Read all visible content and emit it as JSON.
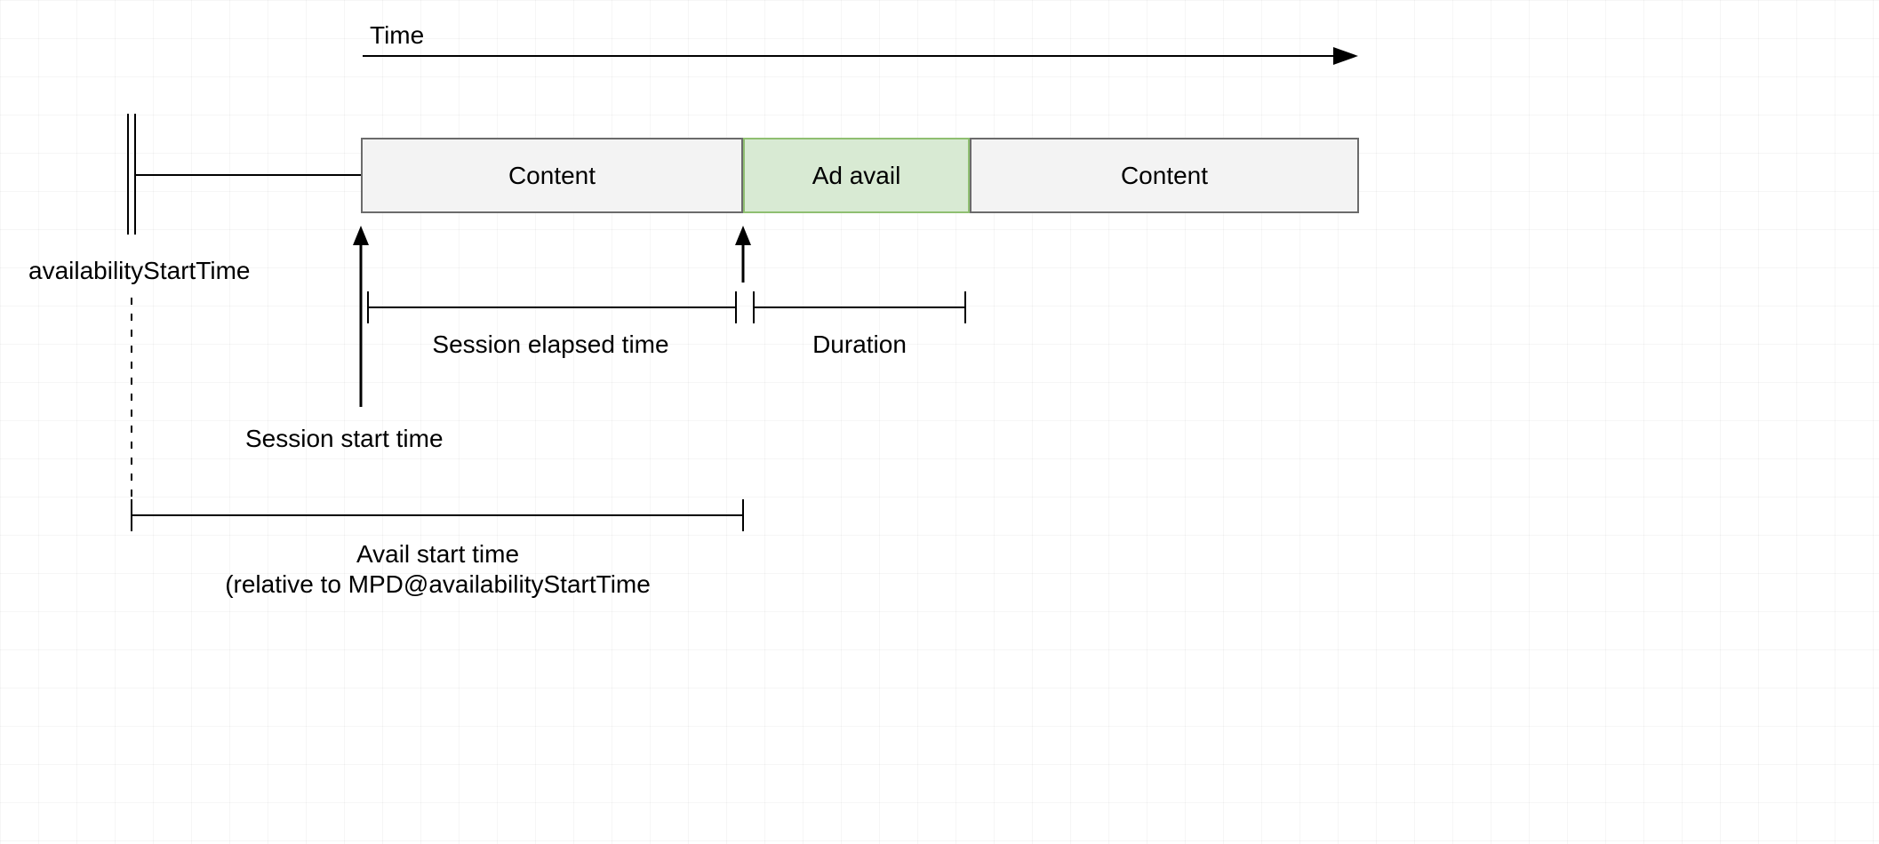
{
  "labels": {
    "time": "Time",
    "availabilityStartTime": "availabilityStartTime",
    "sessionElapsedTime": "Session elapsed time",
    "duration": "Duration",
    "sessionStartTime": "Session start time",
    "availStartTime1": "Avail start time",
    "availStartTime2": "(relative to MPD@availabilityStartTime"
  },
  "blocks": {
    "content1": "Content",
    "adAvail": "Ad avail",
    "content2": "Content"
  }
}
